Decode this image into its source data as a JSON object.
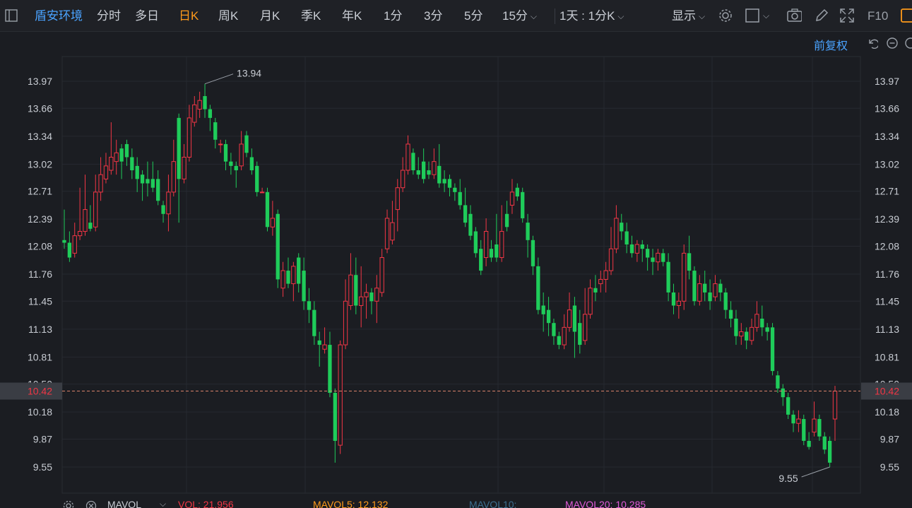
{
  "toolbar": {
    "stock_name": "盾安环境",
    "periods": [
      "分时",
      "多日",
      "日K",
      "周K",
      "月K",
      "季K",
      "年K",
      "1分",
      "3分",
      "5分"
    ],
    "active_period": "日K",
    "dropdown_period": "15分",
    "range_select": "1天 : 1分K",
    "display_label": "显示",
    "f10_label": "F10"
  },
  "sub_toolbar": {
    "adjust_label": "前复权"
  },
  "colors": {
    "up": "#f23645",
    "down": "#1fcc5a",
    "accent_blue": "#4aa3ff",
    "active_orange": "#ff9a1a",
    "current_price_line": "#d9826a"
  },
  "price_axis": {
    "ticks": [
      "13.97",
      "13.66",
      "13.34",
      "13.02",
      "12.71",
      "12.39",
      "12.08",
      "11.76",
      "11.45",
      "11.13",
      "10.81",
      "10.50",
      "10.18",
      "9.87",
      "9.55"
    ],
    "current_price": "10.42"
  },
  "chart_data": {
    "type": "candlestick",
    "high_label": "13.94",
    "low_label": "9.55",
    "ylim": [
      9.55,
      13.97
    ],
    "current_price": 10.42,
    "candles": [
      [
        12.15,
        12.12,
        12.5,
        12.05
      ],
      [
        12.12,
        11.95,
        12.25,
        11.9
      ],
      [
        12.0,
        12.2,
        12.35,
        11.95
      ],
      [
        12.2,
        12.25,
        12.75,
        12.15
      ],
      [
        12.25,
        12.5,
        12.9,
        12.2
      ],
      [
        12.35,
        12.28,
        12.55,
        12.25
      ],
      [
        12.3,
        12.7,
        12.9,
        12.25
      ],
      [
        12.7,
        12.9,
        13.1,
        12.6
      ],
      [
        12.85,
        13.0,
        13.15,
        12.8
      ],
      [
        12.95,
        13.1,
        13.5,
        12.9
      ],
      [
        13.05,
        13.15,
        13.3,
        12.9
      ],
      [
        13.2,
        13.05,
        13.25,
        12.85
      ],
      [
        13.25,
        13.1,
        13.3,
        13.0
      ],
      [
        13.1,
        12.95,
        13.2,
        12.85
      ],
      [
        13.0,
        12.85,
        13.1,
        12.7
      ],
      [
        12.9,
        12.8,
        12.95,
        12.6
      ],
      [
        12.85,
        12.8,
        13.05,
        12.65
      ],
      [
        12.85,
        12.75,
        13.05,
        12.7
      ],
      [
        12.85,
        12.6,
        12.95,
        12.55
      ],
      [
        12.55,
        12.45,
        12.6,
        12.35
      ],
      [
        12.45,
        12.7,
        12.9,
        12.25
      ],
      [
        12.7,
        13.05,
        13.3,
        12.65
      ],
      [
        13.55,
        12.85,
        13.6,
        12.35
      ],
      [
        12.85,
        13.1,
        13.25,
        12.8
      ],
      [
        13.1,
        13.55,
        13.7,
        13.05
      ],
      [
        13.5,
        13.7,
        13.8,
        13.45
      ],
      [
        13.65,
        13.75,
        13.85,
        13.55
      ],
      [
        13.8,
        13.65,
        13.94,
        13.55
      ],
      [
        13.65,
        13.55,
        13.7,
        13.4
      ],
      [
        13.5,
        13.3,
        13.55,
        13.2
      ],
      [
        13.25,
        13.25,
        13.3,
        13.15
      ],
      [
        13.25,
        13.05,
        13.3,
        12.95
      ],
      [
        13.05,
        13.0,
        13.15,
        12.9
      ],
      [
        13.0,
        12.95,
        13.05,
        12.75
      ],
      [
        13.0,
        13.25,
        13.4,
        12.95
      ],
      [
        13.35,
        13.15,
        13.4,
        13.1
      ],
      [
        13.1,
        12.95,
        13.2,
        12.9
      ],
      [
        13.0,
        12.7,
        13.05,
        12.65
      ],
      [
        12.7,
        12.7,
        12.75,
        12.7
      ],
      [
        12.7,
        12.3,
        12.75,
        12.25
      ],
      [
        12.3,
        12.4,
        12.6,
        12.2
      ],
      [
        12.45,
        11.7,
        12.5,
        11.6
      ],
      [
        11.6,
        11.8,
        11.9,
        11.5
      ],
      [
        11.8,
        11.65,
        11.95,
        11.6
      ],
      [
        11.65,
        11.85,
        11.9,
        11.45
      ],
      [
        11.95,
        11.65,
        12.0,
        11.55
      ],
      [
        11.8,
        11.45,
        11.95,
        11.35
      ],
      [
        11.45,
        11.35,
        11.6,
        11.2
      ],
      [
        11.35,
        11.05,
        11.45,
        10.95
      ],
      [
        11.0,
        10.95,
        11.1,
        10.7
      ],
      [
        10.9,
        10.95,
        11.15,
        10.85
      ],
      [
        10.95,
        10.4,
        11.1,
        10.35
      ],
      [
        10.4,
        9.85,
        10.45,
        9.6
      ],
      [
        9.8,
        10.95,
        11.0,
        9.7
      ],
      [
        10.95,
        11.45,
        11.7,
        10.9
      ],
      [
        11.4,
        11.75,
        12.0,
        11.35
      ],
      [
        11.75,
        11.4,
        11.95,
        11.3
      ],
      [
        11.4,
        11.5,
        11.85,
        11.15
      ],
      [
        11.5,
        11.55,
        11.65,
        11.25
      ],
      [
        11.55,
        11.45,
        11.6,
        11.3
      ],
      [
        11.45,
        11.6,
        11.75,
        11.2
      ],
      [
        11.55,
        11.95,
        12.05,
        11.5
      ],
      [
        12.05,
        12.4,
        12.5,
        12.0
      ],
      [
        12.15,
        12.35,
        12.6,
        12.1
      ],
      [
        12.5,
        12.75,
        12.85,
        12.25
      ],
      [
        12.75,
        12.95,
        13.1,
        12.7
      ],
      [
        12.95,
        13.25,
        13.35,
        12.9
      ],
      [
        13.15,
        12.95,
        13.2,
        12.9
      ],
      [
        12.95,
        12.9,
        13.1,
        12.85
      ],
      [
        13.05,
        12.85,
        13.2,
        12.8
      ],
      [
        12.95,
        12.9,
        13.05,
        12.85
      ],
      [
        12.9,
        13.05,
        13.2,
        12.85
      ],
      [
        13.0,
        12.8,
        13.25,
        12.75
      ],
      [
        12.85,
        12.8,
        12.95,
        12.7
      ],
      [
        12.85,
        12.75,
        12.9,
        12.65
      ],
      [
        12.75,
        12.7,
        12.8,
        12.6
      ],
      [
        12.7,
        12.55,
        12.85,
        12.5
      ],
      [
        12.55,
        12.35,
        12.75,
        12.3
      ],
      [
        12.45,
        12.2,
        12.55,
        12.15
      ],
      [
        12.25,
        12.0,
        12.3,
        11.95
      ],
      [
        12.05,
        11.8,
        12.15,
        11.75
      ],
      [
        11.95,
        12.25,
        12.4,
        11.85
      ],
      [
        12.05,
        11.95,
        12.15,
        11.9
      ],
      [
        12.1,
        11.95,
        12.45,
        11.9
      ],
      [
        11.95,
        12.25,
        12.55,
        11.9
      ],
      [
        12.45,
        12.3,
        12.6,
        12.25
      ],
      [
        12.55,
        12.7,
        12.85,
        12.45
      ],
      [
        12.75,
        12.65,
        12.8,
        12.6
      ],
      [
        12.7,
        12.4,
        12.75,
        12.35
      ],
      [
        12.35,
        12.15,
        12.45,
        11.95
      ],
      [
        12.15,
        11.85,
        12.2,
        11.75
      ],
      [
        11.85,
        11.35,
        11.95,
        11.3
      ],
      [
        11.4,
        11.3,
        11.55,
        11.1
      ],
      [
        11.35,
        11.2,
        11.5,
        11.05
      ],
      [
        11.2,
        11.05,
        11.25,
        10.95
      ],
      [
        11.05,
        10.95,
        11.1,
        10.9
      ],
      [
        10.95,
        11.15,
        11.3,
        10.9
      ],
      [
        11.15,
        11.35,
        11.55,
        11.1
      ],
      [
        11.4,
        11.1,
        11.5,
        10.8
      ],
      [
        11.2,
        10.95,
        11.35,
        10.85
      ],
      [
        11.0,
        11.3,
        11.6,
        10.95
      ],
      [
        11.3,
        11.6,
        11.7,
        11.25
      ],
      [
        11.6,
        11.55,
        11.75,
        11.45
      ],
      [
        11.65,
        11.7,
        11.8,
        11.55
      ],
      [
        11.7,
        11.8,
        11.9,
        11.55
      ],
      [
        11.8,
        12.05,
        12.3,
        11.75
      ],
      [
        12.05,
        12.4,
        12.55,
        12.0
      ],
      [
        12.35,
        12.25,
        12.45,
        12.15
      ],
      [
        12.25,
        12.1,
        12.35,
        12.0
      ],
      [
        12.1,
        12.0,
        12.2,
        11.95
      ],
      [
        12.0,
        12.1,
        12.15,
        11.9
      ],
      [
        12.1,
        12.05,
        12.15,
        11.9
      ],
      [
        12.05,
        11.95,
        12.1,
        11.8
      ],
      [
        11.95,
        11.9,
        12.05,
        11.75
      ],
      [
        11.9,
        12.0,
        12.05,
        11.8
      ],
      [
        12.0,
        11.9,
        12.05,
        11.85
      ],
      [
        11.9,
        11.55,
        12.0,
        11.45
      ],
      [
        11.55,
        11.4,
        11.65,
        11.3
      ],
      [
        11.4,
        11.45,
        11.55,
        11.25
      ],
      [
        11.45,
        12.0,
        12.1,
        11.35
      ],
      [
        12.0,
        11.8,
        12.2,
        11.7
      ],
      [
        11.8,
        11.45,
        11.85,
        11.4
      ],
      [
        11.45,
        11.65,
        11.75,
        11.4
      ],
      [
        11.65,
        11.55,
        11.8,
        11.45
      ],
      [
        11.55,
        11.45,
        11.7,
        11.35
      ],
      [
        11.5,
        11.65,
        11.75,
        11.45
      ],
      [
        11.65,
        11.55,
        11.7,
        11.45
      ],
      [
        11.55,
        11.35,
        11.6,
        11.25
      ],
      [
        11.35,
        11.25,
        11.45,
        11.15
      ],
      [
        11.25,
        11.05,
        11.35,
        10.95
      ],
      [
        11.05,
        11.1,
        11.2,
        10.95
      ],
      [
        11.1,
        11.0,
        11.15,
        10.9
      ],
      [
        11.0,
        11.15,
        11.25,
        10.95
      ],
      [
        11.15,
        11.3,
        11.45,
        11.1
      ],
      [
        11.25,
        11.15,
        11.4,
        11.05
      ],
      [
        11.15,
        11.1,
        11.2,
        11.0
      ],
      [
        11.15,
        10.65,
        11.2,
        10.6
      ],
      [
        10.6,
        10.45,
        10.65,
        10.4
      ],
      [
        10.45,
        10.35,
        10.5,
        10.25
      ],
      [
        10.35,
        10.15,
        10.4,
        10.1
      ],
      [
        10.15,
        10.05,
        10.2,
        9.95
      ],
      [
        10.05,
        10.1,
        10.2,
        9.95
      ],
      [
        10.1,
        9.85,
        10.15,
        9.8
      ],
      [
        9.85,
        9.78,
        9.95,
        9.75
      ],
      [
        9.95,
        10.1,
        10.3,
        9.9
      ],
      [
        10.1,
        9.9,
        10.15,
        9.85
      ],
      [
        9.9,
        9.75,
        9.95,
        9.7
      ],
      [
        9.85,
        9.6,
        9.9,
        9.55
      ],
      [
        10.1,
        10.42,
        10.48,
        9.85
      ]
    ]
  },
  "volume_bar": {
    "label": "MAVOL",
    "vol": "VOL: 21.956",
    "mavol5": "MAVOL5: 12.132",
    "mavol10": "MAVOL10:",
    "mavol20": "MAVOL20: 10.285"
  }
}
